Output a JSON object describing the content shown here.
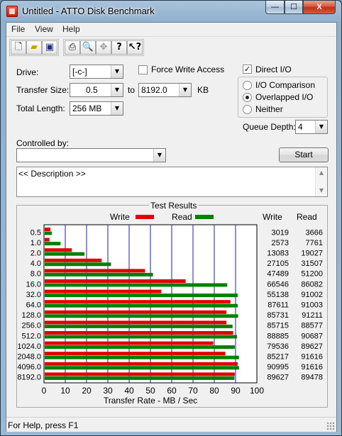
{
  "window": {
    "title": "Untitled - ATTO Disk Benchmark"
  },
  "caption_buttons": {
    "minimize": "—",
    "maximize": "☐",
    "close": "X"
  },
  "menu": [
    "File",
    "View",
    "Help"
  ],
  "toolbar": {
    "icons": [
      "new-file-icon",
      "open-folder-icon",
      "save-icon",
      "print-icon",
      "print-preview-icon",
      "move-icon",
      "help-icon",
      "context-help-icon"
    ]
  },
  "form": {
    "drive_label": "Drive:",
    "drive_value": "[-c-]",
    "force_write_label": "Force Write Access",
    "force_write_checked": false,
    "direct_io_label": "Direct I/O",
    "direct_io_checked": true,
    "transfer_size_label": "Transfer Size:",
    "transfer_from": "0.5",
    "to_label": "to",
    "transfer_to": "8192.0",
    "kb_label": "KB",
    "total_length_label": "Total Length:",
    "total_length_value": "256 MB",
    "io_options": [
      {
        "label": "I/O Comparison",
        "selected": false
      },
      {
        "label": "Overlapped I/O",
        "selected": true
      },
      {
        "label": "Neither",
        "selected": false
      }
    ],
    "queue_depth_label": "Queue Depth:",
    "queue_depth_value": "4",
    "controlled_by_label": "Controlled by:",
    "controlled_by_value": "",
    "start_label": "Start",
    "description": "<< Description >>"
  },
  "results": {
    "frame_title": "Test Results",
    "write_legend": "Write",
    "read_legend": "Read",
    "write_col": "Write",
    "read_col": "Read",
    "write_color": "#e00000",
    "read_color": "#008000"
  },
  "chart_data": {
    "type": "bar",
    "orientation": "horizontal",
    "title": "Test Results",
    "xlabel": "Transfer Rate - MB / Sec",
    "xlim": [
      0,
      100
    ],
    "xticks": [
      0,
      10,
      20,
      30,
      40,
      50,
      60,
      70,
      80,
      90,
      100
    ],
    "grid": true,
    "legend": "top",
    "categories": [
      "0.5",
      "1.0",
      "2.0",
      "4.0",
      "8.0",
      "16.0",
      "32.0",
      "64.0",
      "128.0",
      "256.0",
      "512.0",
      "1024.0",
      "2048.0",
      "4096.0",
      "8192.0"
    ],
    "series": [
      {
        "name": "Write",
        "color": "#e00000",
        "values": [
          3.019,
          2.573,
          13.083,
          27.105,
          47.489,
          66.546,
          55.138,
          87.611,
          85.731,
          85.715,
          88.885,
          79.536,
          85.217,
          90.995,
          89.627
        ]
      },
      {
        "name": "Read",
        "color": "#008000",
        "values": [
          3.666,
          7.761,
          19.027,
          31.507,
          51.2,
          86.082,
          91.002,
          91.003,
          91.211,
          88.577,
          90.687,
          89.627,
          91.616,
          91.616,
          89.478
        ]
      }
    ],
    "table": {
      "write": [
        "3019",
        "2573",
        "13083",
        "27105",
        "47489",
        "66546",
        "55138",
        "87611",
        "85731",
        "85715",
        "88885",
        "79536",
        "85217",
        "90995",
        "89627"
      ],
      "read": [
        "3666",
        "7761",
        "19027",
        "31507",
        "51200",
        "86082",
        "91002",
        "91003",
        "91211",
        "88577",
        "90687",
        "89627",
        "91616",
        "91616",
        "89478"
      ]
    }
  },
  "status": {
    "text": "For Help, press F1"
  }
}
